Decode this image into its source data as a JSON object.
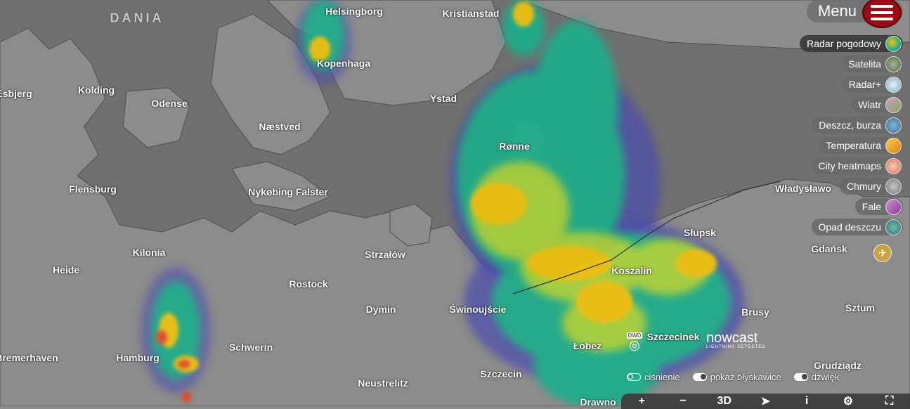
{
  "header": {
    "menu_label": "Menu"
  },
  "layers": [
    {
      "label": "Radar pogodowy",
      "active": true,
      "swatch": "#7cc75a"
    },
    {
      "label": "Satelita",
      "active": false,
      "swatch": "#6f8a5f"
    },
    {
      "label": "Radar+",
      "active": false,
      "swatch": "#9fc6d8"
    },
    {
      "label": "Wiatr",
      "active": false,
      "swatch": "#9b8f6a"
    },
    {
      "label": "Deszcz, burza",
      "active": false,
      "swatch": "#4d8fb8"
    },
    {
      "label": "Temperatura",
      "active": false,
      "swatch": "#e6a21e"
    },
    {
      "label": "City heatmaps",
      "active": false,
      "swatch": "#e09a7a"
    },
    {
      "label": "Chmury",
      "active": false,
      "swatch": "#9a9a9a"
    },
    {
      "label": "Fale",
      "active": false,
      "swatch": "#b35fb8"
    },
    {
      "label": "Opad deszczu",
      "active": false,
      "swatch": "#3f8a7a"
    }
  ],
  "map": {
    "country_label": "DANIA",
    "cities": [
      "Helsingborg",
      "Kristianstad",
      "Kopenhaga",
      "Kolding",
      "Esbjerg",
      "Odense",
      "Ystad",
      "Næstved",
      "Rønne",
      "Flensburg",
      "Nykøbing Falster",
      "Władysławo",
      "Słupsk",
      "Gdańsk",
      "Kilonia",
      "Strzałów",
      "Koszalin",
      "Heide",
      "Rostock",
      "Dymin",
      "Świnoujście",
      "Brusy",
      "Sztum",
      "Hamburg",
      "Schwerin",
      "Łobez",
      "Szczecinek",
      "Bremerhaven",
      "Szczecin",
      "Neustrelitz",
      "Grudziądz",
      "Drawno"
    ]
  },
  "logos": {
    "dwd": "DWD",
    "nowcast_title": "nowcast",
    "nowcast_sub": "LIGHTNING DETECTED"
  },
  "toggles": [
    {
      "label": "ciśnienie",
      "on": false
    },
    {
      "label": "pokaż błyskawice",
      "on": true
    },
    {
      "label": "dźwięk",
      "on": true
    }
  ],
  "toolbar": {
    "zoom_in": "+",
    "zoom_out": "−",
    "view_3d": "3D",
    "locate": "➤",
    "info": "i",
    "settings": "⚙",
    "fullscreen": "⛶"
  },
  "colors": {
    "accent": "#9c0c14",
    "land": "#8a8a8a",
    "sea": "#6e6e6e",
    "radar_low": "#4b4bb0",
    "radar_mid": "#1fae8a",
    "radar_high": "#f1c40f",
    "radar_peak": "#e24b26"
  }
}
